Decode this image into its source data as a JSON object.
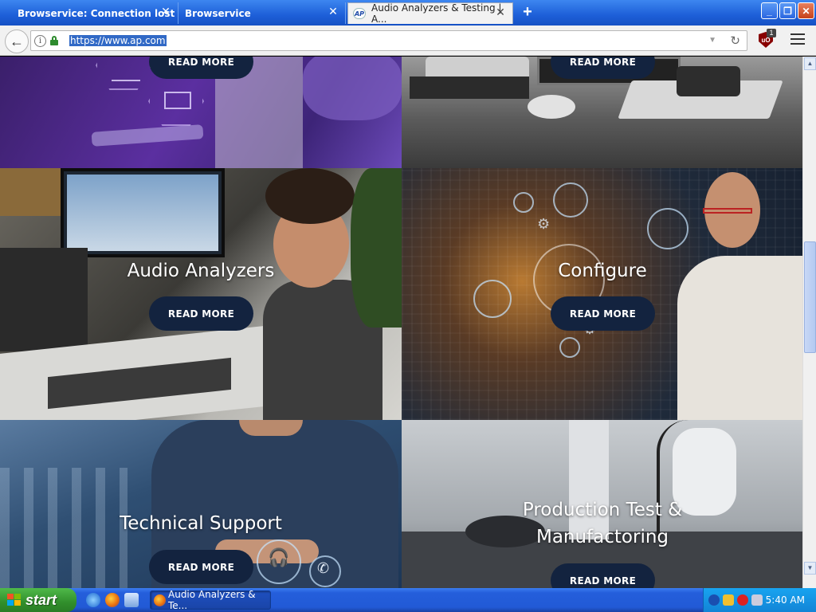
{
  "browser": {
    "tabs": [
      {
        "title": "Browservice: Connection lost",
        "active": false
      },
      {
        "title": "Browservice",
        "active": false
      },
      {
        "title": "Audio Analyzers & Testing | A...",
        "active": true,
        "favicon": "AP"
      }
    ],
    "new_tab_symbol": "+",
    "window_buttons": {
      "minimize": "_",
      "maximize": "❐",
      "close": "✕"
    },
    "url": "https://www.ap.com",
    "ublock_badge": "1",
    "ublock_label": "uO"
  },
  "page": {
    "tiles": [
      {
        "id": "tile-purple",
        "label": "",
        "button": "READ MORE"
      },
      {
        "id": "tile-hardware",
        "label": "",
        "button": "READ MORE"
      },
      {
        "id": "tile-audio-analyzers",
        "label": "Audio Analyzers",
        "button": "READ MORE"
      },
      {
        "id": "tile-configure",
        "label": "Configure",
        "button": "READ MORE"
      },
      {
        "id": "tile-technical-support",
        "label": "Technical Support",
        "button": "READ MORE"
      },
      {
        "id": "tile-production",
        "label": "Production Test &\nManufactoring",
        "label_line1": "Production Test &",
        "label_line2": "Manufactoring",
        "button": "READ MORE"
      }
    ]
  },
  "taskbar": {
    "start_label": "start",
    "task_label": "Audio Analyzers & Te...",
    "clock": "5:40 AM"
  },
  "colors": {
    "xp_blue": "#245edb",
    "start_green": "#318f2c",
    "readmore_bg": "#13233f",
    "url_highlight": "#3169c6"
  }
}
